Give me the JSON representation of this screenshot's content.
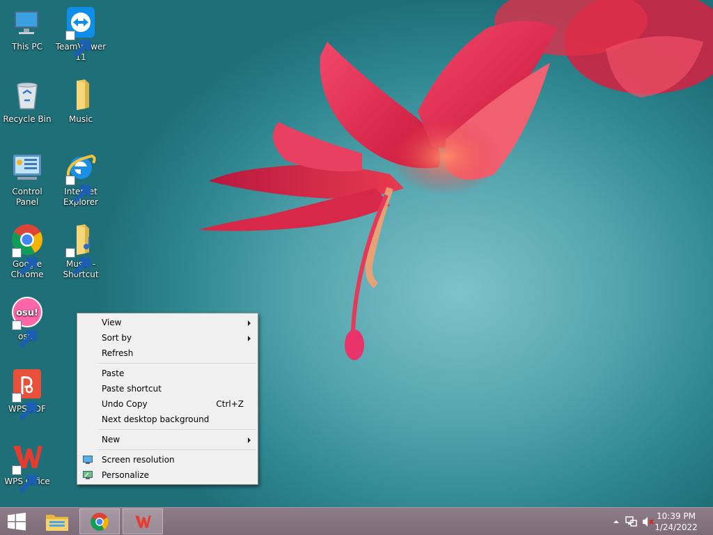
{
  "desktop": {
    "icons": [
      {
        "label": "This PC",
        "icon": "this-pc-icon"
      },
      {
        "label": "TeamViewer\n11",
        "icon": "teamviewer-icon"
      },
      {
        "label": "Recycle Bin",
        "icon": "recycle-bin-icon"
      },
      {
        "label": "Music",
        "icon": "folder-icon"
      },
      {
        "label": "Control Panel",
        "icon": "control-panel-icon"
      },
      {
        "label": "Internet\nExplorer",
        "icon": "internet-explorer-icon"
      },
      {
        "label": "Google\nChrome",
        "icon": "chrome-icon"
      },
      {
        "label": "Music -\nShortcut",
        "icon": "music-folder-icon"
      },
      {
        "label": "osu!",
        "icon": "osu-icon",
        "icon_text": "osu!"
      },
      {
        "label": "WPS PDF",
        "icon": "wps-pdf-icon"
      },
      {
        "label": "WPS Office",
        "icon": "wps-office-icon"
      }
    ]
  },
  "context_menu": {
    "items": [
      {
        "label": "View",
        "submenu": true
      },
      {
        "label": "Sort by",
        "submenu": true
      },
      {
        "label": "Refresh"
      },
      {
        "label": "Paste"
      },
      {
        "label": "Paste shortcut"
      },
      {
        "label": "Undo Copy",
        "shortcut": "Ctrl+Z"
      },
      {
        "label": "Next desktop background"
      },
      {
        "label": "New",
        "submenu": true
      },
      {
        "label": "Screen resolution",
        "icon": "monitor-icon"
      },
      {
        "label": "Personalize",
        "icon": "personalize-icon"
      }
    ]
  },
  "taskbar": {
    "buttons": [
      "windows-start-icon",
      "file-explorer-icon",
      "chrome-icon",
      "wps-office-icon"
    ],
    "tray": {
      "icons": [
        "show-hidden-icons-chevron",
        "network-icon",
        "volume-muted-icon"
      ],
      "time": "10:39 PM",
      "date": "1/24/2022"
    }
  },
  "colors": {
    "wallpaper_teal": "#53a4ad",
    "flower_red": "#e8294a",
    "taskbar": "#86747f",
    "menu_bg": "#f0f0f0"
  }
}
